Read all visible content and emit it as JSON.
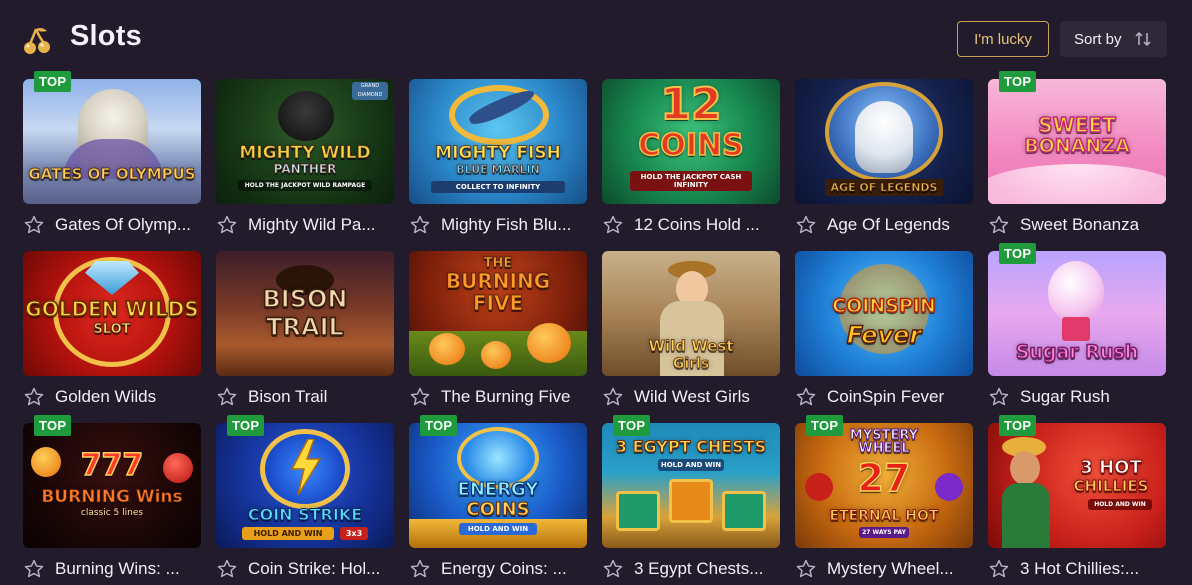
{
  "header": {
    "title": "Slots",
    "lucky_label": "I'm lucky",
    "sort_label": "Sort by"
  },
  "colors": {
    "background": "#211b2b",
    "badge": "#1f9a3c",
    "lucky_border": "#c9a15a"
  },
  "icons": {
    "logo": "cherries-icon",
    "sort": "sort-arrows-icon",
    "favorite": "star-outline-icon"
  },
  "games": [
    {
      "name": "Gates Of Olymp...",
      "badge": "TOP",
      "art": [
        "GATES OF OLYMPUS"
      ]
    },
    {
      "name": "Mighty Wild Pa...",
      "badge": "",
      "art": [
        "MIGHTY WILD",
        "PANTHER",
        "HOLD THE JACKPOT WILD RAMPAGE",
        "GRAND DIAMOND"
      ]
    },
    {
      "name": "Mighty Fish Blu...",
      "badge": "",
      "art": [
        "MIGHTY FISH",
        "BLUE MARLIN",
        "COLLECT TO INFINITY"
      ]
    },
    {
      "name": "12 Coins Hold ...",
      "badge": "",
      "art": [
        "12",
        "COINS",
        "HOLD THE JACKPOT CASH INFINITY"
      ]
    },
    {
      "name": "Age Of Legends",
      "badge": "",
      "art": [
        "AGE OF LEGENDS"
      ]
    },
    {
      "name": "Sweet Bonanza",
      "badge": "TOP",
      "art": [
        "SWEET",
        "BONANZA"
      ]
    },
    {
      "name": "Golden Wilds",
      "badge": "",
      "art": [
        "GOLDEN WILDS",
        "SLOT"
      ]
    },
    {
      "name": "Bison Trail",
      "badge": "",
      "art": [
        "BISON",
        "TRAIL"
      ]
    },
    {
      "name": "The Burning Five",
      "badge": "",
      "art": [
        "THE",
        "BURNING",
        "FIVE"
      ]
    },
    {
      "name": "Wild West Girls",
      "badge": "",
      "art": [
        "Wild West",
        "Girls"
      ]
    },
    {
      "name": "CoinSpin Fever",
      "badge": "",
      "art": [
        "COINSPIN",
        "Fever"
      ]
    },
    {
      "name": "Sugar Rush",
      "badge": "TOP",
      "art": [
        "Sugar Rush"
      ]
    },
    {
      "name": "Burning Wins: ...",
      "badge": "TOP",
      "art": [
        "777",
        "BURNING Wins",
        "classic 5 lines"
      ]
    },
    {
      "name": "Coin Strike: Hol...",
      "badge": "TOP",
      "art": [
        "COIN STRIKE",
        "HOLD AND WIN",
        "3x3"
      ]
    },
    {
      "name": "Energy Coins: ...",
      "badge": "TOP",
      "art": [
        "ENERGY",
        "COINS",
        "HOLD AND WIN"
      ]
    },
    {
      "name": "3 Egypt Chests...",
      "badge": "TOP",
      "art": [
        "3 EGYPT CHESTS",
        "HOLD AND WIN"
      ]
    },
    {
      "name": "Mystery Wheel...",
      "badge": "TOP",
      "art": [
        "MYSTERY",
        "WHEEL",
        "27",
        "ETERNAL HOT",
        "27 WAYS PAY"
      ]
    },
    {
      "name": "3 Hot Chillies:...",
      "badge": "TOP",
      "art": [
        "3 HOT",
        "CHILLIES",
        "HOLD AND WIN"
      ]
    }
  ]
}
